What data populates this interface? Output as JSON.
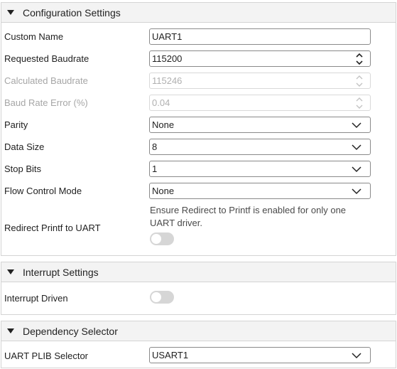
{
  "config": {
    "title": "Configuration Settings",
    "custom_name": {
      "label": "Custom Name",
      "value": "UART1"
    },
    "requested_baudrate": {
      "label": "Requested Baudrate",
      "value": "115200"
    },
    "calculated_baudrate": {
      "label": "Calculated Baudrate",
      "value": "115246"
    },
    "baud_rate_error": {
      "label": "Baud Rate Error (%)",
      "value": "0.04"
    },
    "parity": {
      "label": "Parity",
      "value": "None"
    },
    "data_size": {
      "label": "Data Size",
      "value": "8"
    },
    "stop_bits": {
      "label": "Stop Bits",
      "value": "1"
    },
    "flow_control": {
      "label": "Flow Control Mode",
      "value": "None"
    },
    "redirect": {
      "label": "Redirect Printf to UART",
      "help": "Ensure Redirect to Printf is enabled for only one UART driver.",
      "enabled": false
    }
  },
  "interrupt": {
    "title": "Interrupt Settings",
    "driven": {
      "label": "Interrupt Driven",
      "enabled": false
    }
  },
  "dependency": {
    "title": "Dependency Selector",
    "plib": {
      "label": "UART PLIB Selector",
      "value": "USART1"
    }
  },
  "colors": {
    "toggle_off": "#d6d6d6",
    "header_bg": "#f3f3f3",
    "border": "#d4d4d4"
  },
  "icons": {
    "collapse": "triangle-down-icon",
    "spin": "spin-arrows-icon",
    "dropdown": "chevron-down-icon"
  }
}
